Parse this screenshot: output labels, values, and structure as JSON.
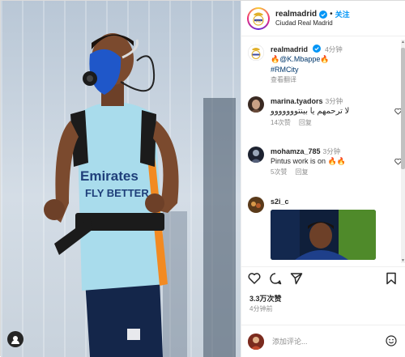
{
  "post": {
    "username": "realmadrid",
    "follow_label": "关注",
    "separator": "•",
    "location": "Ciudad Real Madrid"
  },
  "caption": {
    "username": "realmadrid",
    "time": "4分钟",
    "mention": "@K.Mbappe",
    "fire1": "🔥",
    "fire2": "🔥",
    "hashtag": "#RMCity",
    "translate": "查看翻译"
  },
  "comments": [
    {
      "username": "marina.tyadors",
      "time": "3分钟",
      "text": "لا ترحمهم يا بينتووووووو",
      "likes": "14次赞",
      "reply": "回复"
    },
    {
      "username": "mohamza_785",
      "time": "3分钟",
      "text": "Pintus work is on 🔥🔥",
      "likes": "5次赞",
      "reply": "回复"
    },
    {
      "username": "s2i_c",
      "time": "",
      "text": "",
      "likes": "",
      "reply": ""
    }
  ],
  "stats": {
    "likes": "3.3万次赞",
    "time_ago": "4分钟前"
  },
  "add_comment": {
    "placeholder": "添加评论..."
  },
  "colors": {
    "accent": "#0095f6",
    "text": "#262626",
    "muted": "#8e8e8e"
  },
  "icons": [
    "heart-icon",
    "comment-icon",
    "share-icon",
    "save-icon",
    "emoji-icon",
    "verified-icon"
  ]
}
